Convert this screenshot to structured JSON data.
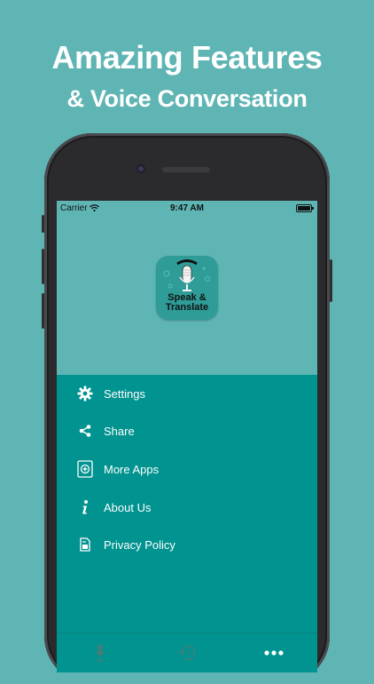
{
  "headline": {
    "title": "Amazing Features",
    "subtitle": "& Voice Conversation"
  },
  "status_bar": {
    "carrier": "Carrier",
    "time": "9:47 AM"
  },
  "app_logo": {
    "line1": "Speak &",
    "line2": "Translate"
  },
  "menu": {
    "items": [
      {
        "label": "Settings",
        "icon": "gear-icon"
      },
      {
        "label": "Share",
        "icon": "share-icon"
      },
      {
        "label": "More Apps",
        "icon": "more-apps-icon"
      },
      {
        "label": "About Us",
        "icon": "info-icon"
      },
      {
        "label": "Privacy Policy",
        "icon": "document-icon"
      }
    ]
  },
  "tab_bar": {
    "tabs": [
      {
        "icon": "microphone-icon"
      },
      {
        "icon": "history-icon"
      },
      {
        "icon": "more-dots-icon"
      }
    ]
  },
  "colors": {
    "background": "#5fb5b4",
    "menu": "#00938f",
    "text": "#ffffff"
  }
}
